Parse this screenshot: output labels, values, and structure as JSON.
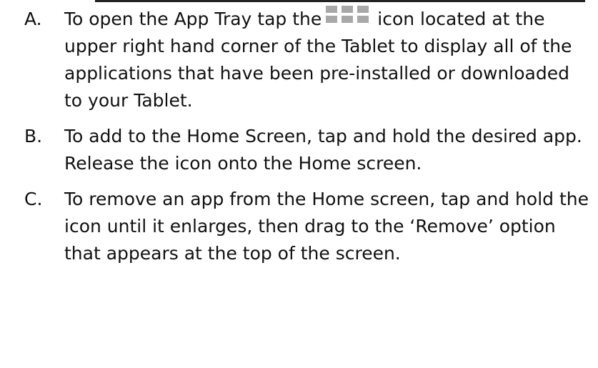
{
  "instructions": [
    {
      "marker": "A.",
      "text_before_icon": "To open the App Tray tap the",
      "icon": "app-grid-icon",
      "text_after_icon": "icon located at the upper right hand corner of the Tablet to display all of the applications that have been pre-installed or downloaded to your Tablet."
    },
    {
      "marker": "B.",
      "text": "To add to the Home Screen, tap and hold the desired app. Release the icon onto the Home screen."
    },
    {
      "marker": "C.",
      "text": "To remove an app from the Home screen, tap and hold the icon until it enlarges, then drag to the ‘Remove’ option that appears at the top of the screen."
    }
  ],
  "colors": {
    "icon_gray": "#a8a8a8",
    "text": "#111111"
  }
}
